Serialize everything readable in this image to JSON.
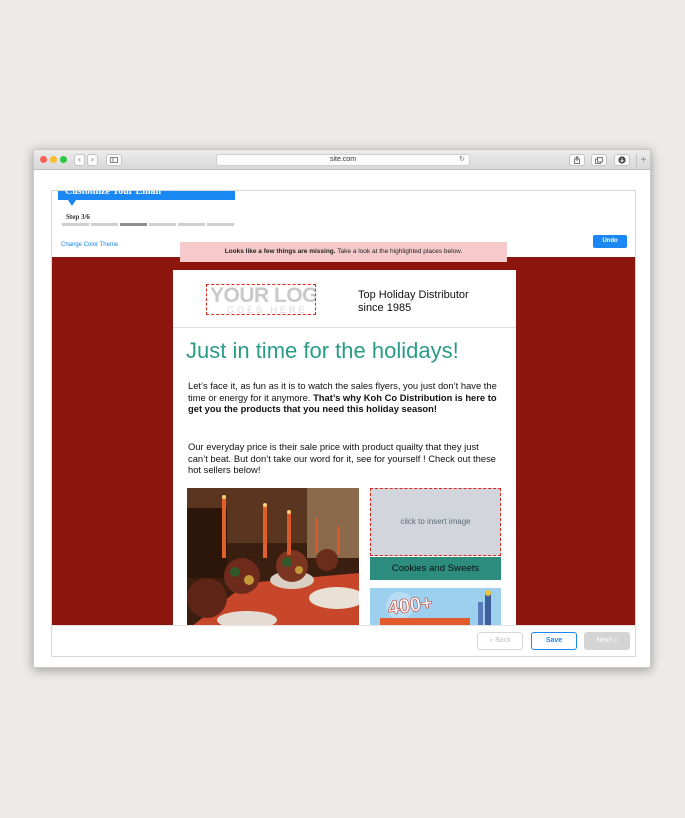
{
  "browser": {
    "url": "site.com",
    "back_icon": "chevron-left-icon",
    "forward_icon": "chevron-right-icon",
    "sidebar_icon": "sidebar-icon",
    "reload_icon": "reload-icon",
    "share_icon": "share-icon",
    "tabs_icon": "tabs-icon",
    "download_icon": "download-icon",
    "new_tab_icon": "plus-icon"
  },
  "wizard": {
    "title": "Customize Your Email",
    "step_label": "Step 3/6",
    "current_step": 3,
    "total_steps": 6,
    "color_theme_link": "Change Color Theme",
    "undo_label": "Undo",
    "alert_bold": "Looks like a few things are missing.",
    "alert_text": " Take a look at the highlighted places below."
  },
  "email": {
    "logo_text": "YOUR LOGO",
    "logo_subtext": "GOES HERE",
    "tagline": "Top Holiday Distributor since 1985",
    "headline": "Just in time for the holidays!",
    "para1_text": "Let’s face it, as fun as it is to watch the sales flyers, you just don’t have the time or energy for it anymore. ",
    "para1_bold": "That’s why Koh Co Distribution is here to get you the products that you need this holiday season!",
    "para2": "Our everyday price is their sale price with product quailty that they just can’t beat. But don’t take our word for it, see for yourself ! Check out these hot sellers below!",
    "insert_image_label": "click to insert image",
    "category_button": "Cookies and Sweets",
    "promo_text": "400+"
  },
  "footer": {
    "back_label": "« Back",
    "save_label": "Save",
    "next_label": "Next »"
  },
  "colors": {
    "accent": "#1a87f2",
    "canvas_bg": "#8c160e",
    "headline": "#2a9b86",
    "alert_bg": "#f6caca",
    "missing_border": "#e0261a",
    "category_button_bg": "#2c8c7e"
  }
}
